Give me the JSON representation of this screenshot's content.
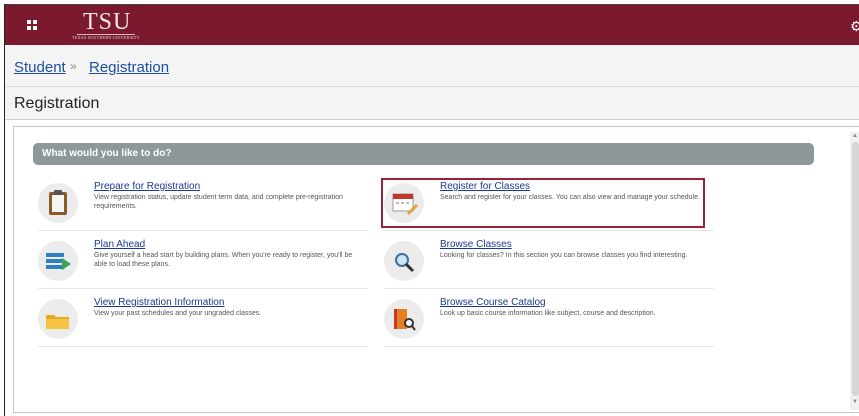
{
  "header": {
    "logo_text": "TSU",
    "logo_subtext": "TEXAS SOUTHERN UNIVERSITY",
    "menu_icon": "grid-icon",
    "settings_icon": "gear-icon",
    "brand_color": "#7b1a2e"
  },
  "breadcrumb": {
    "items": [
      "Student",
      "Registration"
    ],
    "separator": "»"
  },
  "page": {
    "title": "Registration"
  },
  "section": {
    "title": "What would you like to do?"
  },
  "actions": [
    {
      "title": "Prepare for Registration",
      "description": "View registration status, update student term data, and complete pre-registration requirements.",
      "icon": "clipboard-icon"
    },
    {
      "title": "Register for Classes",
      "description": "Search and register for your classes. You can also view and manage your schedule.",
      "icon": "calendar-pencil-icon",
      "highlighted": true
    },
    {
      "title": "Plan Ahead",
      "description": "Give yourself a head start by building plans. When you're ready to register, you'll be able to load these plans.",
      "icon": "plan-list-icon"
    },
    {
      "title": "Browse Classes",
      "description": "Looking for classes? In this section you can browse classes you find interesting.",
      "icon": "magnifier-icon"
    },
    {
      "title": "View Registration Information",
      "description": "View your past schedules and your ungraded classes.",
      "icon": "folder-icon"
    },
    {
      "title": "Browse Course Catalog",
      "description": "Look up basic course information like subject, course and description.",
      "icon": "book-search-icon"
    }
  ]
}
